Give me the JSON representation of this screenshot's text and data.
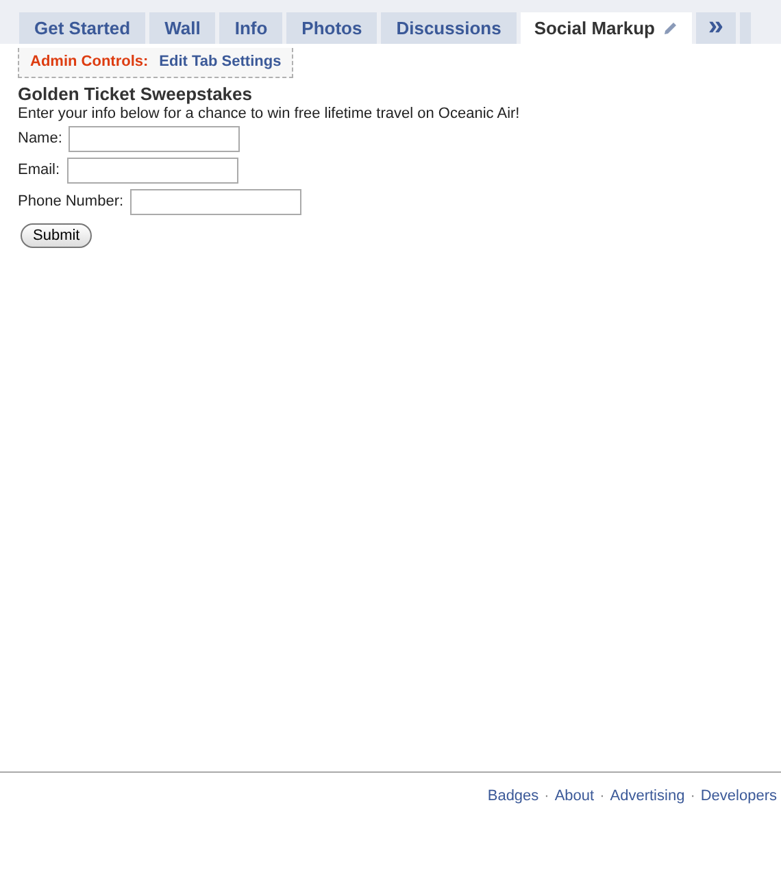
{
  "tabs": [
    {
      "label": "Get Started",
      "selected": false
    },
    {
      "label": "Wall",
      "selected": false
    },
    {
      "label": "Info",
      "selected": false
    },
    {
      "label": "Photos",
      "selected": false
    },
    {
      "label": "Discussions",
      "selected": false
    },
    {
      "label": "Social Markup",
      "selected": true,
      "editable": true
    }
  ],
  "more_tabs": {
    "label": "»"
  },
  "admin_controls": {
    "label": "Admin Controls:",
    "link": "Edit Tab Settings"
  },
  "content": {
    "title": "Golden Ticket Sweepstakes",
    "intro": "Enter your info below for a chance to win free lifetime travel on Oceanic Air!",
    "fields": [
      {
        "label": "Name:"
      },
      {
        "label": "Email:"
      },
      {
        "label": "Phone Number:"
      }
    ],
    "submit": "Submit"
  },
  "footer": {
    "separator": "·",
    "links": [
      "Badges",
      "About",
      "Advertising",
      "Developers"
    ]
  }
}
